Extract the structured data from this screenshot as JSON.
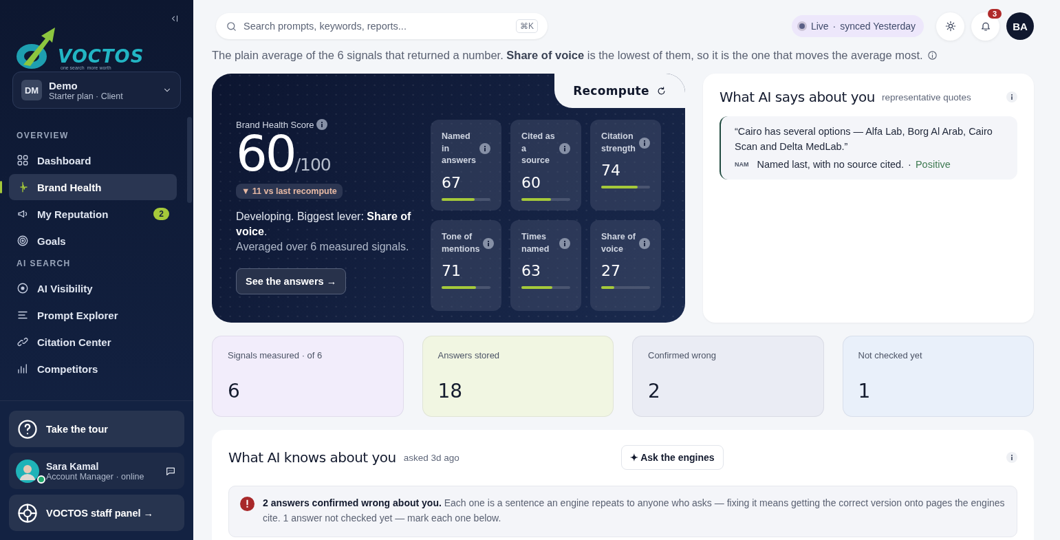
{
  "sidebar": {
    "logo": {
      "name": "VOCTOS",
      "tagline": "one search  more worth"
    },
    "workspace": {
      "initials": "DM",
      "name": "Demo",
      "plan": "Starter plan · Client"
    },
    "sections": [
      {
        "heading": "OVERVIEW",
        "items": [
          {
            "label": "Dashboard",
            "selected": false
          },
          {
            "label": "Brand Health",
            "selected": true
          },
          {
            "label": "My Reputation",
            "selected": false,
            "badge": "2"
          },
          {
            "label": "Goals",
            "selected": false
          }
        ]
      },
      {
        "heading": "AI SEARCH",
        "items": [
          {
            "label": "AI Visibility",
            "selected": false
          },
          {
            "label": "Prompt Explorer",
            "selected": false
          },
          {
            "label": "Citation Center",
            "selected": false
          },
          {
            "label": "Competitors",
            "selected": false
          }
        ]
      }
    ],
    "tour": "Take the tour",
    "manager": {
      "name": "Sara Kamal",
      "role": "Account Manager · online",
      "online": true
    },
    "staff_panel": "VOCTOS staff panel →"
  },
  "topbar": {
    "search": {
      "placeholder": "Search prompts, keywords, reports...",
      "shortcut": "⌘K"
    },
    "status": {
      "label": "Live",
      "separator": "·",
      "synced": "synced Yesterday"
    },
    "notifications": "3",
    "avatar": "BA"
  },
  "summary": "The plain average of the 6 signals that returned a number. **Share of voice** is the lowest of them, so it is the one that moves the average most.",
  "score_card": {
    "label": "Brand Health Score",
    "score": "60",
    "out_of": "/100",
    "delta": "▼ 11 vs last recompute",
    "verdict": "Developing. Biggest lever: **Share of voice**.",
    "note": "Averaged over 6 measured signals.",
    "action": "See the answers →",
    "recompute": "Recompute",
    "signals": [
      {
        "label": "Named in answers",
        "value": "67",
        "level": 0.67
      },
      {
        "label": "Cited as a source",
        "value": "60",
        "level": 0.6
      },
      {
        "label": "Citation strength",
        "value": "74",
        "level": 0.74
      },
      {
        "label": "Tone of mentions",
        "value": "71",
        "level": 0.71
      },
      {
        "label": "Times named",
        "value": "63",
        "level": 0.63
      },
      {
        "label": "Share of voice",
        "value": "27",
        "level": 0.27
      }
    ]
  },
  "quotes": {
    "title": "What AI says about you",
    "subtitle": "representative quotes",
    "items": [
      {
        "quote": "“Cairo has several options — Alfa Lab, Borg Al Arab, Cairo Scan and Delta MedLab.”",
        "tag": "NAM",
        "note": "Named last, with no source cited.",
        "separator": "·",
        "sentiment": "Positive"
      }
    ]
  },
  "stats": [
    {
      "label": "Signals measured · of 6",
      "value": "6",
      "color": "#f2edfb"
    },
    {
      "label": "Answers stored",
      "value": "18",
      "color": "#f1f6e2"
    },
    {
      "label": "Confirmed wrong",
      "value": "2",
      "color": "#eaecf4"
    },
    {
      "label": "Not checked yet",
      "value": "1",
      "color": "#e9f0fa"
    }
  ],
  "knowledge": {
    "title": "What AI knows about you",
    "asked": "asked 3d ago",
    "action": "✦ Ask the engines",
    "alert": "**2 answers confirmed wrong about you.** Each one is a sentence an engine repeats to anyone who asks — fixing it means getting the correct version onto pages the engines cite. 1 answer not checked yet — mark each one below."
  }
}
